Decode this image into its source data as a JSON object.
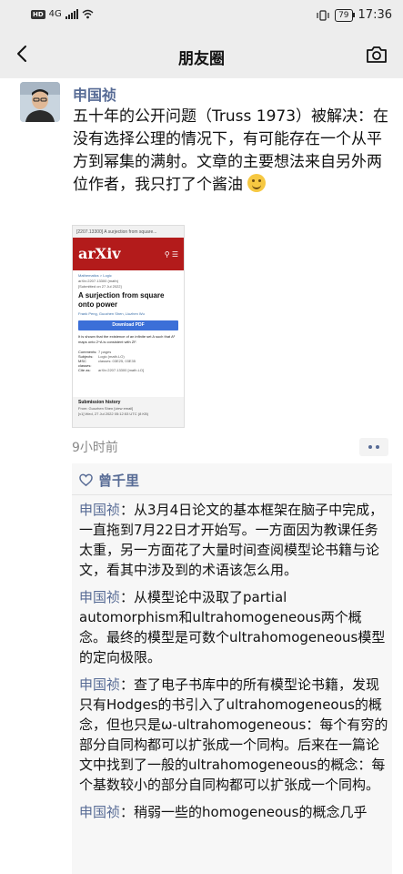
{
  "status": {
    "network": "4G",
    "battery": "79",
    "time": "17:36"
  },
  "nav": {
    "title": "朋友圈"
  },
  "post": {
    "author": "申国祯",
    "text": "五十年的公开问题（Truss 1973）被解决：在没有选择公理的情况下，有可能存在一个从平方到幂集的满射。文章的主要想法来自另外两位作者，我只打了个酱油",
    "time": "9小时前"
  },
  "shot": {
    "tab": "[2207.13300] A surjection from square...",
    "logo": "arXiv",
    "crumb": "Mathematics > Logic",
    "arxiv_id": "arXiv:2207.13300 (math)",
    "submitted": "[Submitted on 27 Jul 2022]",
    "title": "A surjection from square onto power",
    "authors": "Frank Peng, Guozhen Shen, Liuzhen Wu",
    "download": "Download PDF",
    "abstract": "It is shown that the existence of an infinite set A such that A² maps onto 2^A is consistent with ZF.",
    "meta": [
      {
        "k": "Comments:",
        "v": "7 pages"
      },
      {
        "k": "Subjects:",
        "v": "Logic (math.LO)"
      },
      {
        "k": "MSC",
        "v": "classes: 03E25, 03E35"
      },
      {
        "k": "classes:",
        "v": ""
      },
      {
        "k": "Cite as:",
        "v": "arXiv:2207.13300 [math.LO]"
      }
    ],
    "history_title": "Submission history",
    "history_from": "From: Guozhen Shen [view email]",
    "history_v1": "[v1] Wed, 27 Jul 2022 05:12:53 UTC (8 KB)"
  },
  "likes": {
    "names": "曾千里"
  },
  "comments": [
    {
      "name": "申国祯",
      "text": "从3月4日论文的基本框架在脑子中完成，一直拖到7月22日才开始写。一方面因为教课任务太重，另一方面花了大量时间查阅模型论书籍与论文，看其中涉及到的术语该怎么用。"
    },
    {
      "name": "申国祯",
      "text": "从模型论中汲取了partial automorphism和ultrahomogeneous两个概念。最终的模型是可数个ultrahomogeneous模型的定向极限。"
    },
    {
      "name": "申国祯",
      "text": "查了电子书库中的所有模型论书籍，发现只有Hodges的书引入了ultrahomogeneous的概念，但也只是ω-ultrahomogeneous：每个有穷的部分自同构都可以扩张成一个同构。后来在一篇论文中找到了一般的ultrahomogeneous的概念：每个基数较小的部分自同构都可以扩张成一个同构。"
    },
    {
      "name": "申国祯",
      "text": "稍弱一些的homogeneous的概念几乎"
    }
  ],
  "colors": {
    "link": "#576b95",
    "arxiv_red": "#b31b1b",
    "bar": "#ededed"
  }
}
